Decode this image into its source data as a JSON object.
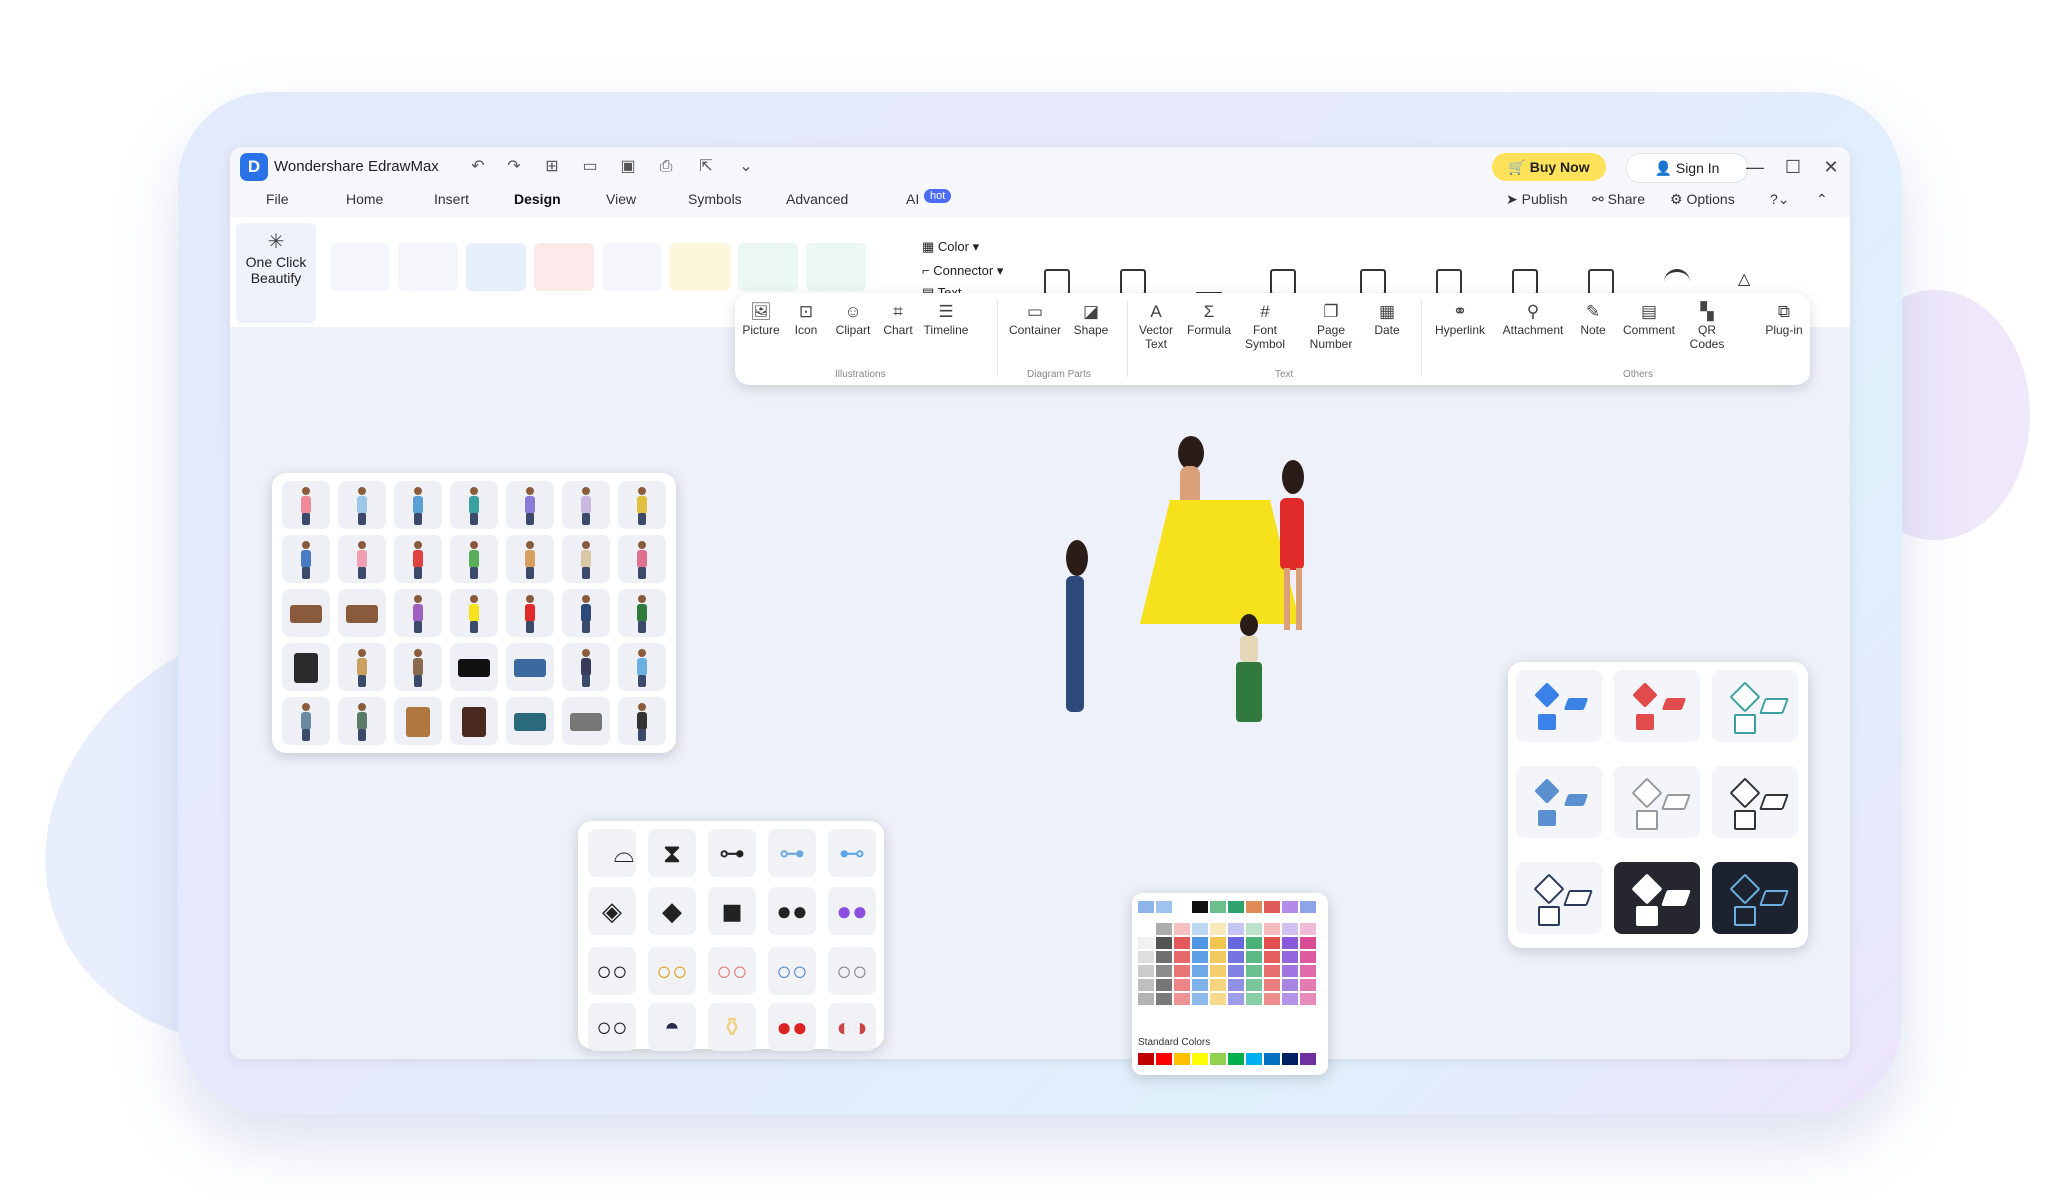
{
  "titlebar": {
    "app_title": "Wondershare EdrawMax",
    "buy_now": "Buy Now",
    "sign_in": "Sign In"
  },
  "menu": {
    "tabs": [
      "File",
      "Home",
      "Insert",
      "Design",
      "View",
      "Symbols",
      "Advanced",
      "AI"
    ],
    "active_tab": "Design",
    "hot_badge": "hot",
    "publish": "Publish",
    "share": "Share",
    "options": "Options"
  },
  "ribbon": {
    "one_click": "One Click",
    "beautify": "Beautify",
    "color": "Color",
    "connector": "Connector",
    "text": "Text"
  },
  "toolbar": {
    "illustrations": {
      "label": "Illustrations",
      "tools": [
        "Picture",
        "Icon",
        "Clipart",
        "Chart",
        "Timeline"
      ]
    },
    "diagram_parts": {
      "label": "Diagram Parts",
      "tools": [
        "Container",
        "Shape"
      ]
    },
    "text": {
      "label": "Text",
      "tools": [
        "Vector Text",
        "Formula",
        "Font Symbol",
        "Page Number",
        "Date"
      ]
    },
    "others": {
      "label": "Others",
      "tools": [
        "Hyperlink",
        "Attachment",
        "Note",
        "Comment",
        "QR Codes",
        "Plug-in"
      ]
    }
  },
  "color_picker": {
    "standard_colors_label": "Standard Colors",
    "top_row": [
      "#8fb4ea",
      "#9fc3ef",
      "#ffffff",
      "#111111",
      "#6abf8c",
      "#2fa36b",
      "#e08b5a",
      "#e05a5a",
      "#b38be8",
      "#8ea4e8"
    ],
    "grid_columns": [
      "#ffffff",
      "#222222",
      "#e14b4b",
      "#3f8de0",
      "#f0c040",
      "#5b5bdb",
      "#3bab6b",
      "#e04040",
      "#7e4bd6",
      "#d63c8c"
    ],
    "standard": [
      "#c00000",
      "#ff0000",
      "#ffc000",
      "#ffff00",
      "#92d050",
      "#00b050",
      "#00b0f0",
      "#0070c0",
      "#002060",
      "#7030a0"
    ]
  },
  "colors": {
    "accent": "#2a72e8",
    "buy_now": "#ffe15a",
    "hot_badge": "#4a6cf7"
  }
}
